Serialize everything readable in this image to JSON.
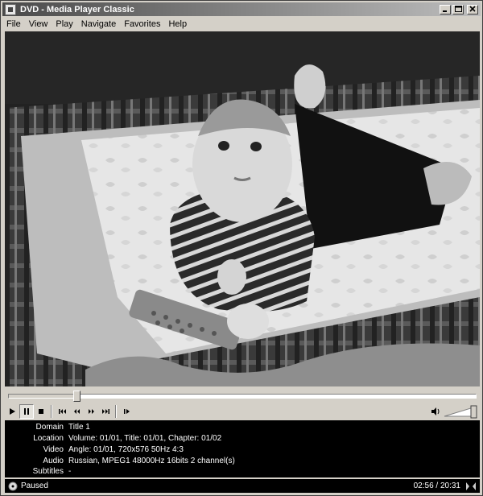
{
  "window": {
    "title": "DVD - Media Player Classic"
  },
  "menu": [
    "File",
    "View",
    "Play",
    "Navigate",
    "Favorites",
    "Help"
  ],
  "playback": {
    "position_fraction": 0.144,
    "volume_fraction": 1.0
  },
  "info": {
    "rows": [
      {
        "label": "Domain",
        "value": "Title 1"
      },
      {
        "label": "Location",
        "value": "Volume: 01/01, Title: 01/01, Chapter: 01/02"
      },
      {
        "label": "Video",
        "value": "Angle: 01/01, 720x576 50Hz 4:3"
      },
      {
        "label": "Audio",
        "value": "Russian, MPEG1 48000Hz 16bits 2 channel(s)"
      },
      {
        "label": "Subtitles",
        "value": "-"
      }
    ]
  },
  "status": {
    "state": "Paused",
    "time": "02:56 / 20:31"
  },
  "icons": {
    "play": "play-icon",
    "pause": "pause-icon",
    "stop": "stop-icon",
    "prev": "previous-chapter-icon",
    "rewind": "rewind-icon",
    "forward": "fast-forward-icon",
    "next": "next-chapter-icon",
    "frame_step": "frame-step-icon",
    "volume": "speaker-icon"
  }
}
